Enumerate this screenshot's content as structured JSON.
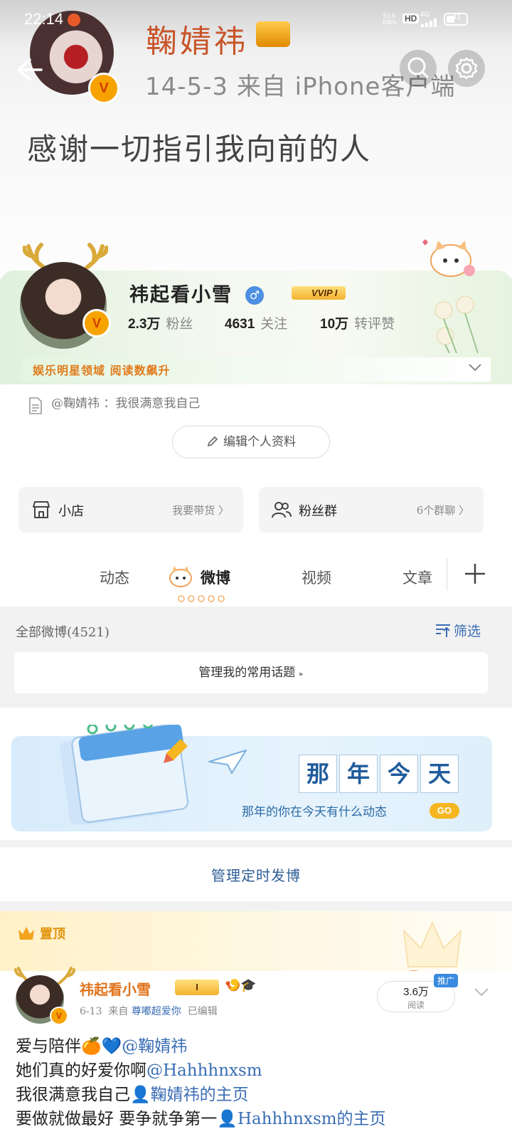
{
  "status_bar": {
    "time": "22:14",
    "speed": "51.6",
    "speed_unit": "KB/s",
    "hd": "HD",
    "network": "4G",
    "battery": "41"
  },
  "cover": {
    "name": "鞠婧祎",
    "meta": "14-5-3  来自 iPhone客户端",
    "text": "感谢一切指引我向前的人"
  },
  "profile": {
    "username": "祎起看小雪",
    "gender_symbol": "♂",
    "vip_label": "VVIP I",
    "stats": [
      {
        "value": "2.3万",
        "label": "粉丝"
      },
      {
        "value": "4631",
        "label": "关注"
      },
      {
        "value": "10万",
        "label": "转评赞"
      }
    ],
    "tag": "娱乐明星领域 阅读数飙升",
    "bio": "@鞠婧祎 ：我很满意我自己",
    "edit_button": "编辑个人资料",
    "shop": {
      "label": "小店",
      "action": "我要带货 〉"
    },
    "fans_group": {
      "label": "粉丝群",
      "action": "6个群聊 〉"
    }
  },
  "tabs": [
    "动态",
    "微博",
    "视频",
    "文章"
  ],
  "active_tab": "微博",
  "filter": {
    "all_posts": "全部微博(4521)",
    "filter_label": "筛选",
    "topics": "管理我的常用话题",
    "topics_arrow": "▸"
  },
  "memory": {
    "chars": [
      "那",
      "年",
      "今",
      "天"
    ],
    "subtitle": "那年的你在今天有什么动态",
    "go": "GO"
  },
  "scheduled": "管理定时发博",
  "pinned": {
    "label": "置顶",
    "author": "祎起看小雪",
    "badge": "I",
    "icons": "🍤🎓",
    "date": "6-13",
    "from": "来自",
    "source": "尊嘟超爱你",
    "edited": "已编辑",
    "reads": "3.6万",
    "reads_label": "阅读",
    "promo": "推广",
    "lines": [
      {
        "text": "爱与陪伴🍊💙",
        "at": "@鞠婧祎"
      },
      {
        "text": "她们真的好爱你啊",
        "at": "@Hahhhnxsm"
      },
      {
        "text": "我很满意我自己",
        "at": "👤鞠婧祎的主页"
      },
      {
        "text": "要做就做最好 要争就争第一",
        "at": "👤Hahhhnxsm的主页"
      }
    ]
  },
  "colors": {
    "accent_orange": "#e0731b",
    "link_blue": "#3a6db5",
    "vip_gold": "#f3b230"
  }
}
